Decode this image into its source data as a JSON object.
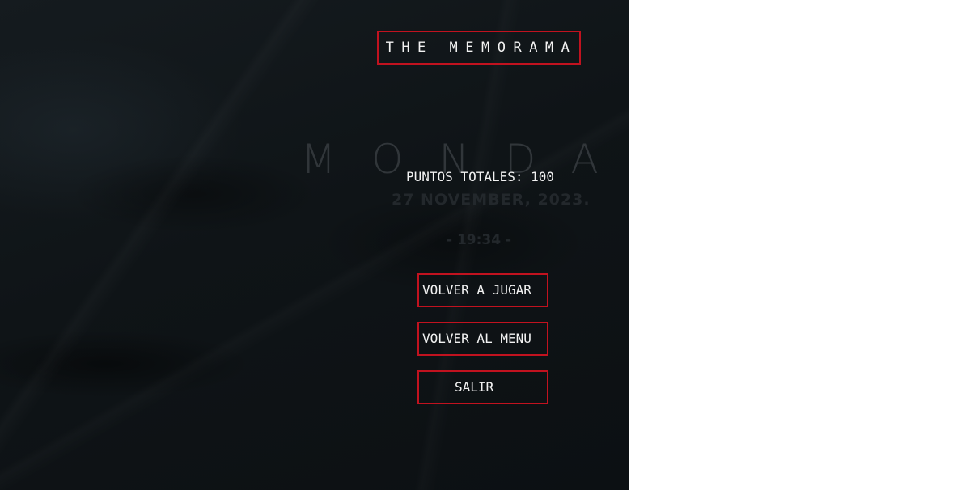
{
  "game": {
    "title": "THE MEMORAMA",
    "score_text": "PUNTOS TOTALES: 100"
  },
  "background": {
    "watermark_text": "MONDAY",
    "date_text": "27 NOVEMBER, 2023.",
    "time_text": "- 19:34 -"
  },
  "menu": {
    "play_again_label": "VOLVER A JUGAR",
    "back_to_menu_label": "VOLVER AL MENU",
    "exit_label": "SALIR"
  },
  "colors": {
    "accent_border": "#c1121f",
    "text": "#f2f2f2",
    "background": "#0f1417"
  }
}
